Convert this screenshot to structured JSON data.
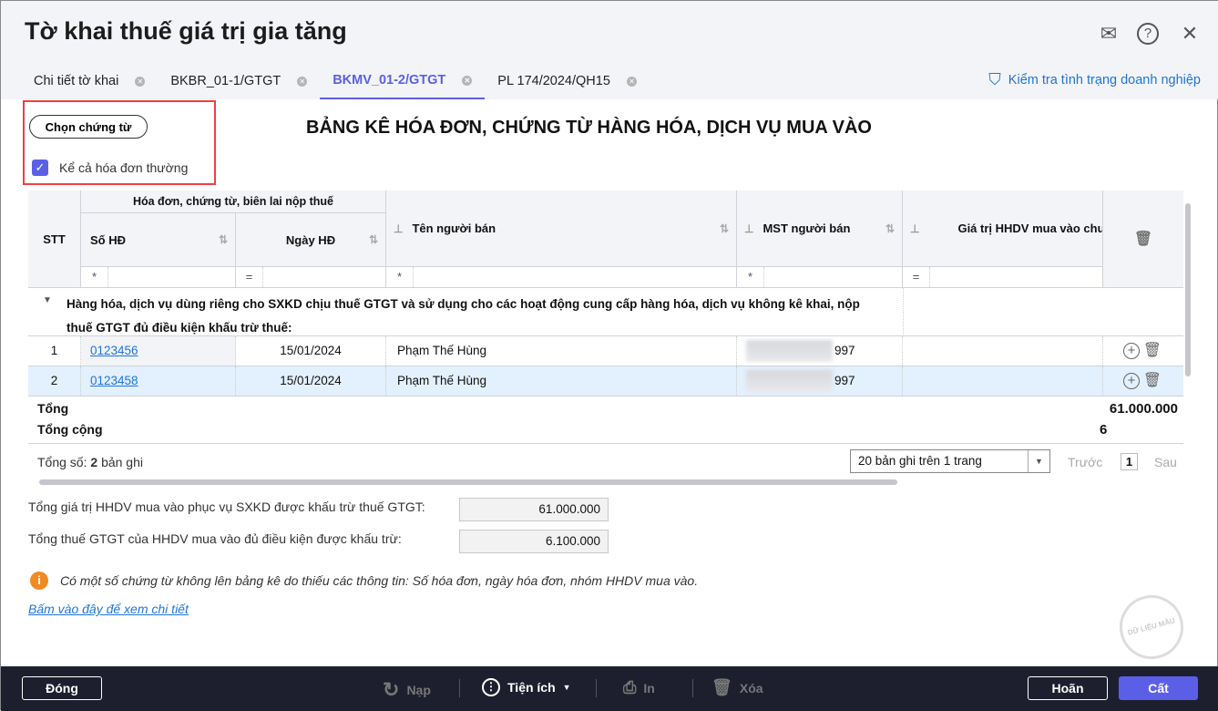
{
  "window": {
    "title": "Tờ khai thuế giá trị gia tăng"
  },
  "tabs": [
    {
      "label": "Chi tiết tờ khai"
    },
    {
      "label": "BKBR_01-1/GTGT"
    },
    {
      "label": "BKMV_01-2/GTGT",
      "active": true
    },
    {
      "label": "PL 174/2024/QH15"
    }
  ],
  "check_company": "Kiểm tra tình trạng doanh nghiệp",
  "choose_button": "Chọn chứng từ",
  "include_normal": {
    "label": "Kể cả hóa đơn thường",
    "checked": true
  },
  "heading": "BẢNG KÊ HÓA ĐƠN, CHỨNG TỪ HÀNG HÓA, DỊCH VỤ MUA VÀO",
  "table": {
    "group_header": "Hóa đơn, chứng từ, biên lai nộp thuế",
    "columns": {
      "stt": "STT",
      "so_hd": "Số HĐ",
      "ngay_hd": "Ngày HĐ",
      "ten": "Tên người bán",
      "mst": "MST người bán",
      "gia_tri": "Giá trị HHDV mua vào chu"
    },
    "filters": {
      "so_hd": "*",
      "ngay_hd": "=",
      "ten": "*",
      "mst": "*",
      "gia_tri": "="
    },
    "group_row": "Hàng hóa, dịch vụ dùng riêng cho SXKD chịu thuế GTGT và sử dụng cho các hoạt động cung cấp hàng hóa, dịch vụ không kê khai, nộp thuế GTGT đủ điều kiện khấu trừ thuế:",
    "rows": [
      {
        "stt": "1",
        "so_hd": "0123456",
        "ngay_hd": "15/01/2024",
        "ten": "Phạm Thế Hùng",
        "mst": "997"
      },
      {
        "stt": "2",
        "so_hd": "0123458",
        "ngay_hd": "15/01/2024",
        "ten": "Phạm Thế Hùng",
        "mst": "997"
      }
    ],
    "total_label": "Tổng",
    "total_value": "61.000.000",
    "grand_total_label": "Tổng cộng",
    "grand_total_value": "6"
  },
  "pager": {
    "count_prefix": "Tổng số:",
    "count": "2",
    "count_suffix": "bản ghi",
    "page_size": "20 bản ghi trên 1 trang",
    "prev": "Trước",
    "page": "1",
    "next": "Sau"
  },
  "summary": [
    {
      "label": "Tổng giá trị HHDV mua vào phục vụ SXKD được khấu trừ thuế GTGT:",
      "value": "61.000.000"
    },
    {
      "label": "Tổng thuế GTGT của HHDV mua vào đủ điều kiện được khấu trừ:",
      "value": "6.100.000"
    }
  ],
  "notice": "Có một số chứng từ không lên bảng kê do thiếu các thông tin: Số hóa đơn, ngày hóa đơn, nhóm HHDV mua vào.",
  "detail_link": "Bấm vào đây để xem chi tiết",
  "watermark": "DỮ LIỆU MẪU",
  "footer": {
    "close": "Đóng",
    "reload": "Nạp",
    "utilities": "Tiện ích",
    "print": "In",
    "delete": "Xóa",
    "undo": "Hoãn",
    "save": "Cất"
  },
  "colors": {
    "accent": "#5b5fe8",
    "link": "#1e76d8",
    "bar": "#1e1f2e",
    "highlight": "#e3f0fd"
  }
}
